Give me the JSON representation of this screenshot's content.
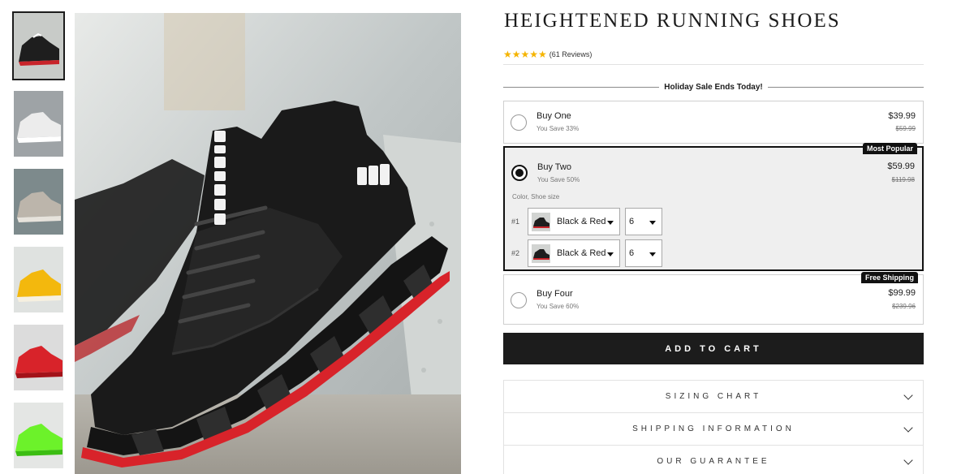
{
  "product": {
    "title": "HEIGHTENED RUNNING SHOES",
    "stars": "★★★★★",
    "rating": 5,
    "reviews": "(61 Reviews)"
  },
  "thumbnails": [
    {
      "icon": "black-shoe-image",
      "color": "#1e1e1e"
    },
    {
      "icon": "white-shoe-image",
      "color": "#e9e9e9"
    },
    {
      "icon": "grey-shoe-image",
      "color": "#b9b3aa"
    },
    {
      "icon": "yellow-shoe-image",
      "color": "#f3b80d"
    },
    {
      "icon": "red-shoe-image",
      "color": "#d8232a"
    },
    {
      "icon": "green-shoe-image",
      "color": "#6cf22a"
    }
  ],
  "sale_banner": "Holiday Sale Ends Today!",
  "bundles": [
    {
      "name": "Buy One",
      "save": "You Save 33%",
      "price": "$39.99",
      "old_price": "$59.99",
      "badge": "",
      "selected": false
    },
    {
      "name": "Buy Two",
      "save": "You Save 50%",
      "price": "$59.99",
      "old_price": "$119.98",
      "badge": "Most Popular",
      "selected": true,
      "variant_label": "Color, Shoe size",
      "variants": [
        {
          "num": "#1",
          "color": "Black & Red",
          "size": "6"
        },
        {
          "num": "#2",
          "color": "Black & Red",
          "size": "6"
        }
      ]
    },
    {
      "name": "Buy Four",
      "save": "You Save 60%",
      "price": "$99.99",
      "old_price": "$239.96",
      "badge": "Free Shipping",
      "selected": false
    }
  ],
  "add_to_cart": "ADD TO CART",
  "accordions": [
    "SIZING CHART",
    "SHIPPING INFORMATION",
    "OUR GUARANTEE"
  ],
  "colors": {
    "accent": "#1c1c1c",
    "star": "#f5b400",
    "sole": "#d8232a"
  }
}
